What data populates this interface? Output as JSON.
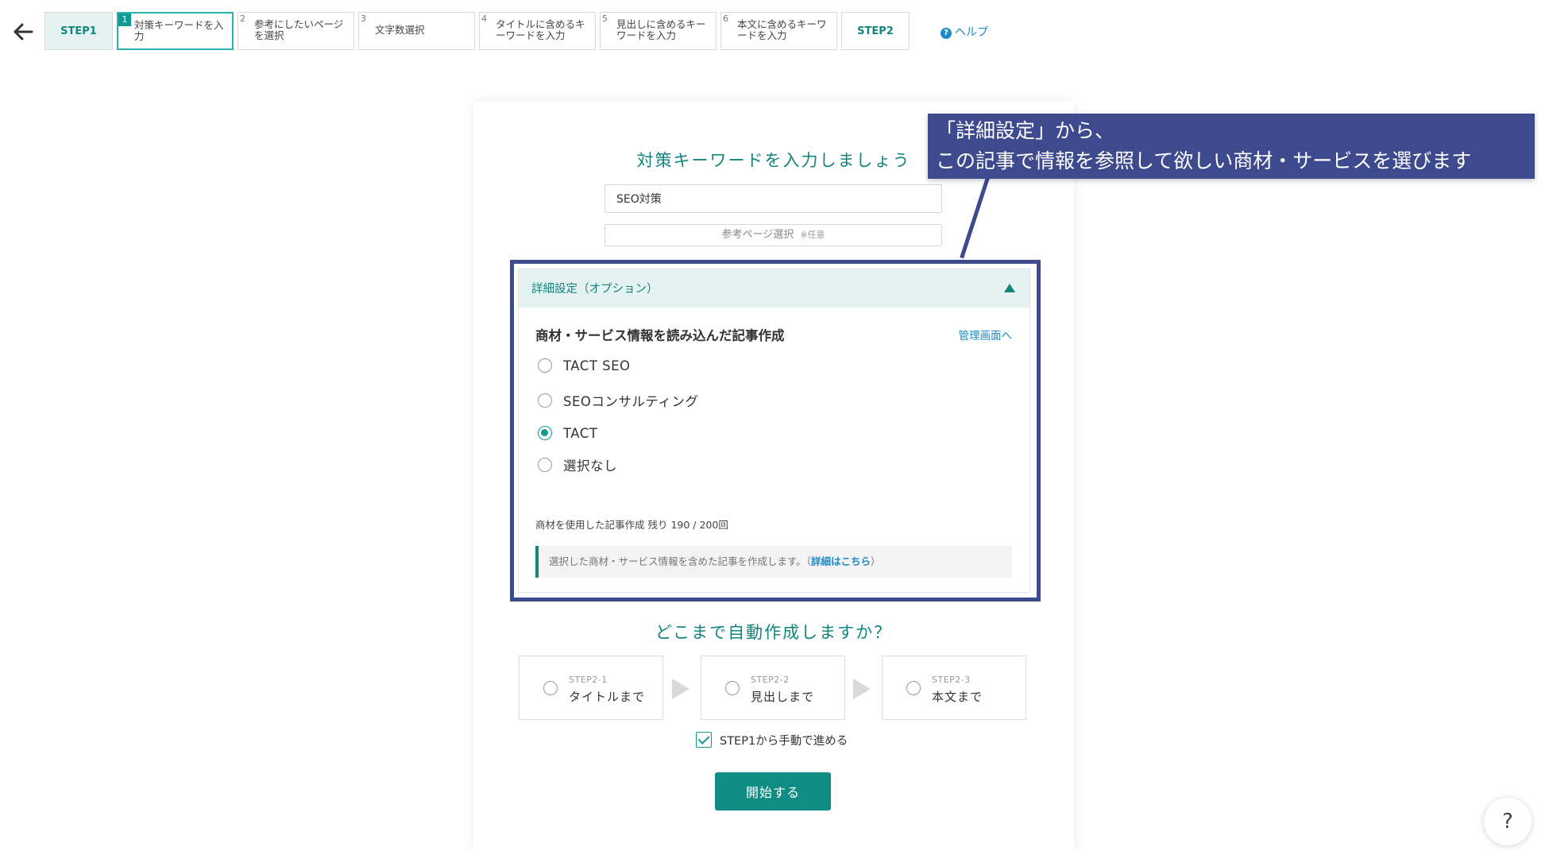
{
  "nav": {
    "steps": [
      {
        "label": "STEP1"
      },
      {
        "num": "1",
        "label": "対策キーワードを入力"
      },
      {
        "num": "2",
        "label": "参考にしたいページを選択"
      },
      {
        "num": "3",
        "label": "文字数選択"
      },
      {
        "num": "4",
        "label": "タイトルに含めるキーワードを入力"
      },
      {
        "num": "5",
        "label": "見出しに含めるキーワードを入力"
      },
      {
        "num": "6",
        "label": "本文に含めるキーワードを入力"
      },
      {
        "label": "STEP2"
      }
    ],
    "help_label": "ヘルプ"
  },
  "form": {
    "heading": "対策キーワードを入力しましょう",
    "keyword_value": "SEO対策",
    "ref_page_label": "参考ページ選択",
    "ref_page_optional": "※任意"
  },
  "advanced": {
    "title": "詳細設定（オプション）",
    "section_title": "商材・サービス情報を読み込んだ記事作成",
    "manage_link": "管理画面へ",
    "options": [
      "TACT SEO",
      "SEOコンサルティング",
      "TACT",
      "選択なし"
    ],
    "selected_option": "TACT",
    "usage_text": "商材を使用した記事作成 残り 190 / 200回",
    "info_text": "選択した商材・サービス情報を含めた記事を作成します。（",
    "info_link": "詳細はこちら",
    "info_close": "）"
  },
  "auto": {
    "heading": "どこまで自動作成しますか？",
    "steps": [
      {
        "sub": "STEP2-1",
        "label": "タイトルまで"
      },
      {
        "sub": "STEP2-2",
        "label": "見出しまで"
      },
      {
        "sub": "STEP2-3",
        "label": "本文まで"
      }
    ],
    "manual_label": "STEP1から手動で進める",
    "start_button": "開始する"
  },
  "callout": {
    "line1": "「詳細設定」から、",
    "line2": "この記事で情報を参照して欲しい商材・サービスを選びます"
  },
  "fab_label": "?",
  "colors": {
    "teal": "#119a91",
    "navy": "#3d4b8e",
    "link": "#1c8bc7"
  }
}
